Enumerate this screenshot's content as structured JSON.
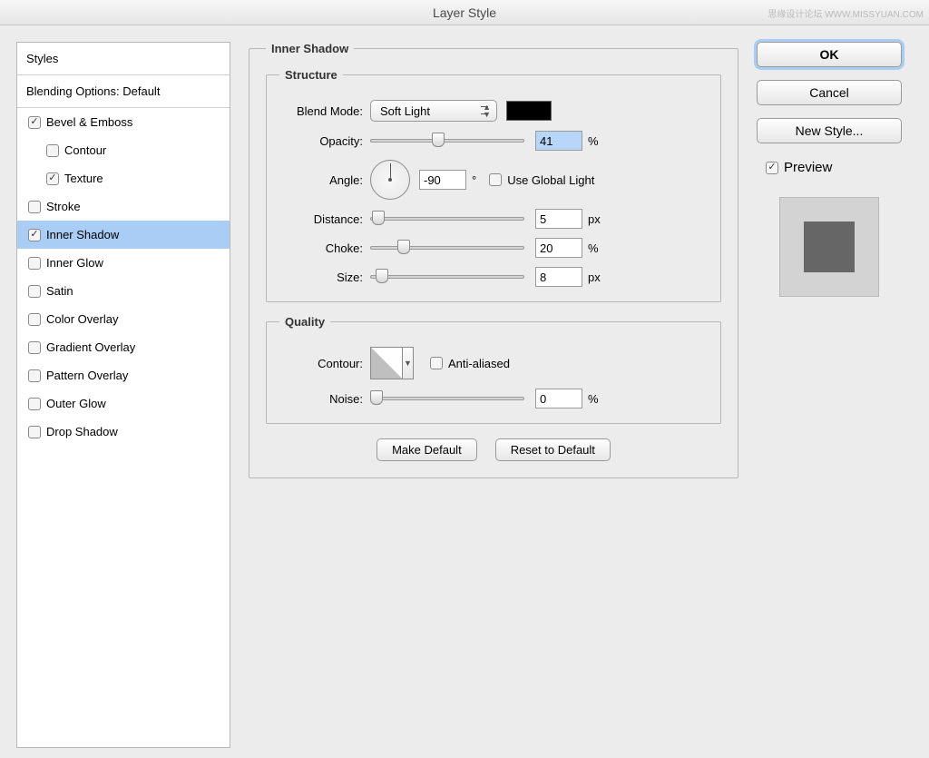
{
  "watermark": "思缘设计论坛  WWW.MISSYUAN.COM",
  "window": {
    "title": "Layer Style"
  },
  "sidebar": {
    "header": "Styles",
    "blending": "Blending Options: Default",
    "items": [
      {
        "label": "Bevel & Emboss",
        "checked": true,
        "indent": false
      },
      {
        "label": "Contour",
        "checked": false,
        "indent": true
      },
      {
        "label": "Texture",
        "checked": true,
        "indent": true
      },
      {
        "label": "Stroke",
        "checked": false,
        "indent": false
      },
      {
        "label": "Inner Shadow",
        "checked": true,
        "indent": false,
        "selected": true
      },
      {
        "label": "Inner Glow",
        "checked": false,
        "indent": false
      },
      {
        "label": "Satin",
        "checked": false,
        "indent": false
      },
      {
        "label": "Color Overlay",
        "checked": false,
        "indent": false
      },
      {
        "label": "Gradient Overlay",
        "checked": false,
        "indent": false
      },
      {
        "label": "Pattern Overlay",
        "checked": false,
        "indent": false
      },
      {
        "label": "Outer Glow",
        "checked": false,
        "indent": false
      },
      {
        "label": "Drop Shadow",
        "checked": false,
        "indent": false
      }
    ]
  },
  "panel": {
    "title": "Inner Shadow",
    "structure": {
      "legend": "Structure",
      "blend_mode_label": "Blend Mode:",
      "blend_mode_value": "Soft Light",
      "color": "#000000",
      "opacity_label": "Opacity:",
      "opacity_value": "41",
      "opacity_unit": "%",
      "angle_label": "Angle:",
      "angle_value": "-90",
      "angle_unit": "°",
      "global_light_label": "Use Global Light",
      "global_light_checked": false,
      "distance_label": "Distance:",
      "distance_value": "5",
      "distance_unit": "px",
      "choke_label": "Choke:",
      "choke_value": "20",
      "choke_unit": "%",
      "size_label": "Size:",
      "size_value": "8",
      "size_unit": "px"
    },
    "quality": {
      "legend": "Quality",
      "contour_label": "Contour:",
      "antialiased_label": "Anti-aliased",
      "antialiased_checked": false,
      "noise_label": "Noise:",
      "noise_value": "0",
      "noise_unit": "%"
    },
    "buttons": {
      "make_default": "Make Default",
      "reset_default": "Reset to Default"
    }
  },
  "right": {
    "ok": "OK",
    "cancel": "Cancel",
    "new_style": "New Style...",
    "preview_label": "Preview",
    "preview_checked": true
  }
}
